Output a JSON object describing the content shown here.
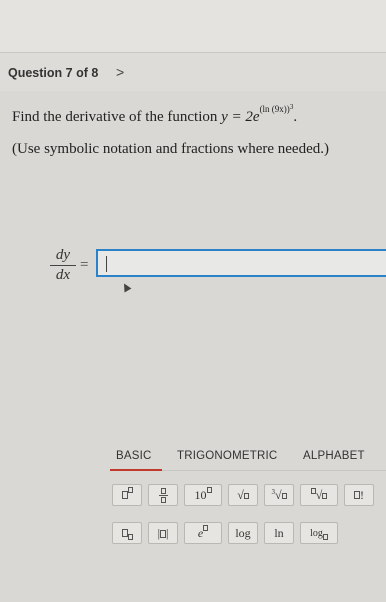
{
  "question": {
    "label": "Question 7 of 8",
    "next_label": ">",
    "prompt_lead": "Find the derivative of the function",
    "prompt_math": "y = 2e",
    "prompt_exponent": "(ln (9x))",
    "prompt_exponent_power": "3",
    "prompt_end": ".",
    "note": "(Use symbolic notation and fractions where needed.)"
  },
  "answer": {
    "numerator": "dy",
    "denominator": "dx",
    "equals": "=",
    "value": ""
  },
  "palette": {
    "tabs": [
      "BASIC",
      "TRIGONOMETRIC",
      "ALPHABET"
    ],
    "active_tab": "BASIC",
    "keys": {
      "ten_power": "10",
      "e_power": "e",
      "log": "log",
      "ln": "ln",
      "log_base": "log",
      "factorial": "!",
      "root_index_3": "3"
    }
  }
}
